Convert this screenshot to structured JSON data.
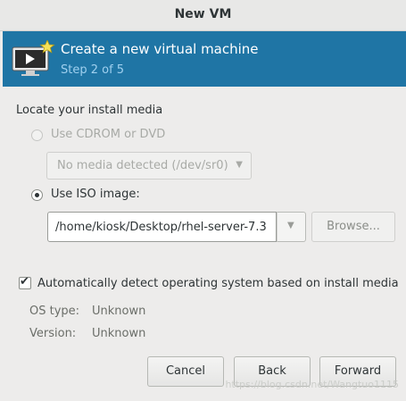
{
  "window": {
    "title": "New VM"
  },
  "banner": {
    "headline": "Create a new virtual machine",
    "step": "Step 2 of 5",
    "icon": "vm-monitor-icon",
    "color": "#1f75a5"
  },
  "install_media": {
    "section_label": "Locate your install media",
    "cdrom": {
      "label": "Use CDROM or DVD",
      "selected": false,
      "enabled": false,
      "combo_value": "No media detected (/dev/sr0)"
    },
    "iso": {
      "label": "Use ISO image:",
      "selected": true,
      "path": "/home/kiosk/Desktop/rhel-server-7.3",
      "browse_label": "Browse..."
    }
  },
  "os_detect": {
    "label": "Automatically detect operating system based on install media",
    "checked": true,
    "os_type_label": "OS type:",
    "os_type_value": "Unknown",
    "version_label": "Version:",
    "version_value": "Unknown"
  },
  "buttons": {
    "cancel": "Cancel",
    "back": "Back",
    "forward": "Forward"
  },
  "watermark": "https://blog.csdn.net/Wangtuo1115"
}
